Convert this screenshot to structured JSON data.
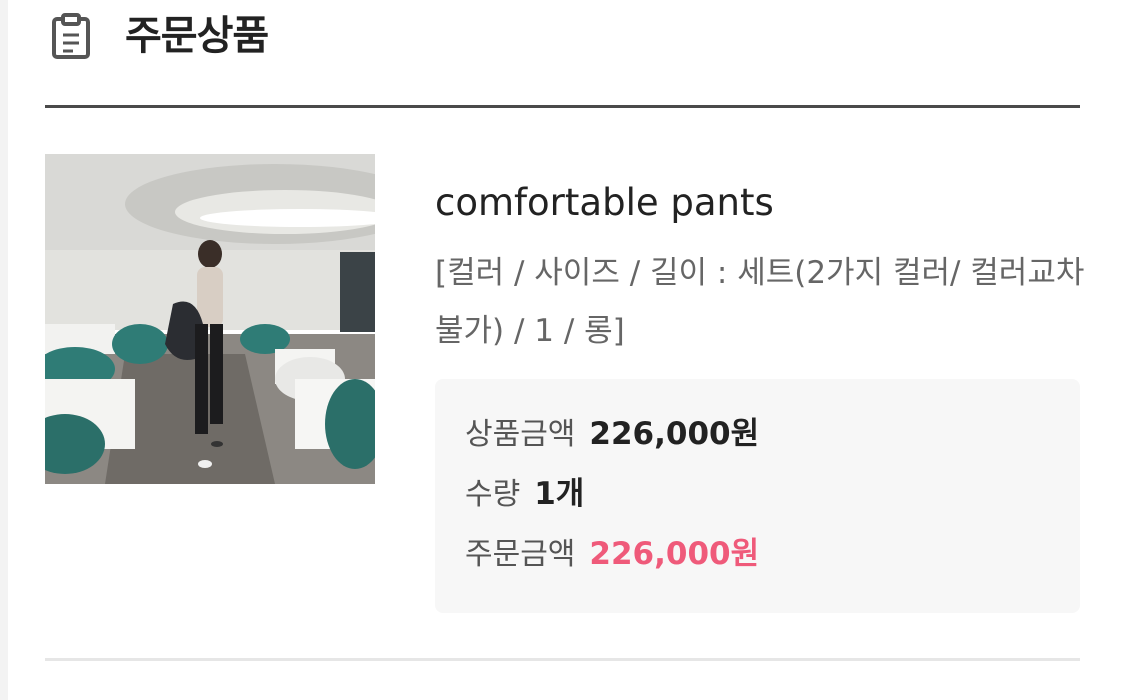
{
  "section": {
    "icon": "clipboard-icon",
    "title": "주문상품"
  },
  "product": {
    "image_icon": "product-photo",
    "name": "comfortable pants",
    "option": "[컬러 / 사이즈 / 길이 : 세트(2가지 컬러/ 컬러교차불가) / 1 / 롱]"
  },
  "summary": {
    "product_amount_label": "상품금액",
    "product_amount_value": "226,000원",
    "quantity_label": "수량",
    "quantity_value": "1개",
    "order_amount_label": "주문금액",
    "order_amount_value": "226,000원"
  },
  "colors": {
    "accent": "#ef5a7a",
    "header_rule": "#4a4a4a",
    "box_bg": "#f7f7f7"
  }
}
